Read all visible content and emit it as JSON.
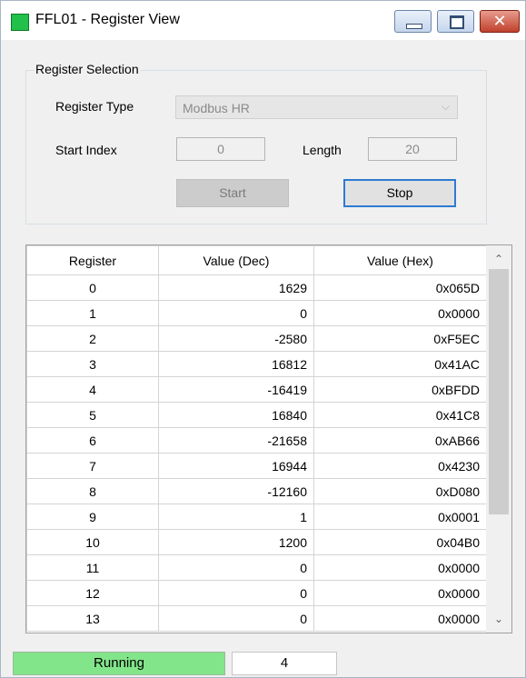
{
  "window": {
    "title": "FFL01 - Register View",
    "minimize_glyph": "",
    "maximize_glyph": "",
    "close_glyph": "✕"
  },
  "selection": {
    "group_label": "Register Selection",
    "register_type_label": "Register Type",
    "register_type_value": "Modbus HR",
    "start_index_label": "Start Index",
    "start_index_value": "0",
    "length_label": "Length",
    "length_value": "20",
    "start_button": "Start",
    "stop_button": "Stop"
  },
  "table": {
    "headers": [
      "Register",
      "Value (Dec)",
      "Value (Hex)"
    ],
    "rows": [
      [
        "0",
        "1629",
        "0x065D"
      ],
      [
        "1",
        "0",
        "0x0000"
      ],
      [
        "2",
        "-2580",
        "0xF5EC"
      ],
      [
        "3",
        "16812",
        "0x41AC"
      ],
      [
        "4",
        "-16419",
        "0xBFDD"
      ],
      [
        "5",
        "16840",
        "0x41C8"
      ],
      [
        "6",
        "-21658",
        "0xAB66"
      ],
      [
        "7",
        "16944",
        "0x4230"
      ],
      [
        "8",
        "-12160",
        "0xD080"
      ],
      [
        "9",
        "1",
        "0x0001"
      ],
      [
        "10",
        "1200",
        "0x04B0"
      ],
      [
        "11",
        "0",
        "0x0000"
      ],
      [
        "12",
        "0",
        "0x0000"
      ],
      [
        "13",
        "0",
        "0x0000"
      ]
    ]
  },
  "scrollbar": {
    "up_arrow": "⌃",
    "down_arrow": "⌄"
  },
  "status": {
    "state": "Running",
    "count": "4",
    "running_color": "#82e58a"
  },
  "icons": {
    "app": "green-square-icon",
    "dropdown": "chevron-down-icon"
  }
}
